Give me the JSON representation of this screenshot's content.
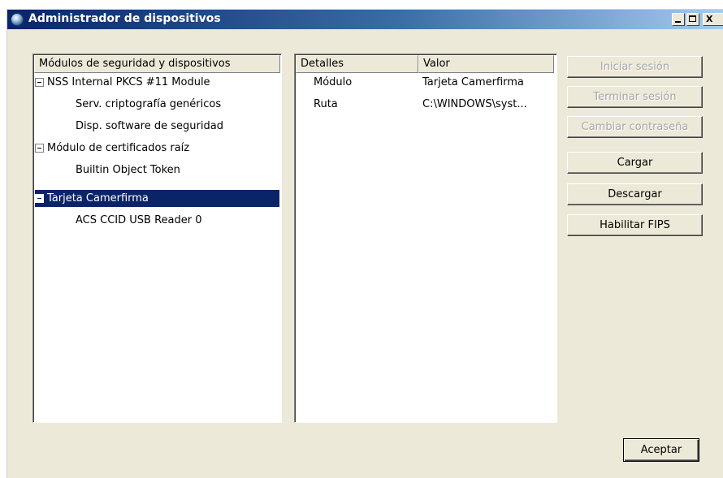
{
  "window": {
    "title": "Administrador de dispositivos",
    "controls": {
      "minimize": "_",
      "maximize": "□",
      "close": "X"
    }
  },
  "tree": {
    "header": "Módulos de seguridad y dispositivos",
    "rows": [
      {
        "label": "NSS Internal PKCS #11 Module",
        "level": 0,
        "expanded": true,
        "selected": false
      },
      {
        "label": "Serv. criptografía genéricos",
        "level": 1,
        "selected": false
      },
      {
        "label": "Disp. software de seguridad",
        "level": 1,
        "selected": false
      },
      {
        "label": "Módulo de certificados raíz",
        "level": 0,
        "expanded": true,
        "selected": false
      },
      {
        "label": "Builtin Object Token",
        "level": 1,
        "selected": false
      },
      {
        "label": "Tarjeta Camerfirma",
        "level": 0,
        "expanded": true,
        "selected": true
      },
      {
        "label": "ACS CCID USB Reader 0",
        "level": 1,
        "selected": false
      }
    ]
  },
  "details": {
    "columns": [
      "Detalles",
      "Valor"
    ],
    "rows": [
      {
        "key": "Módulo",
        "value": "Tarjeta Camerfirma"
      },
      {
        "key": "Ruta",
        "value": "C:\\WINDOWS\\syst..."
      }
    ]
  },
  "buttons": {
    "iniciar_sesion": {
      "label": "Iniciar sesión",
      "enabled": false
    },
    "terminar_sesion": {
      "label": "Terminar sesión",
      "enabled": false
    },
    "cambiar_contrasena": {
      "label": "Cambiar contraseña",
      "enabled": false
    },
    "cargar": {
      "label": "Cargar",
      "enabled": true
    },
    "descargar": {
      "label": "Descargar",
      "enabled": true
    },
    "habilitar_fips": {
      "label": "Habilitar FIPS",
      "enabled": true
    },
    "aceptar": {
      "label": "Aceptar",
      "enabled": true
    }
  },
  "colors": {
    "titlebar_start": "#0a246a",
    "titlebar_end": "#a6caf0",
    "selection": "#0a246a",
    "dialog_bg": "#ece9d8"
  }
}
